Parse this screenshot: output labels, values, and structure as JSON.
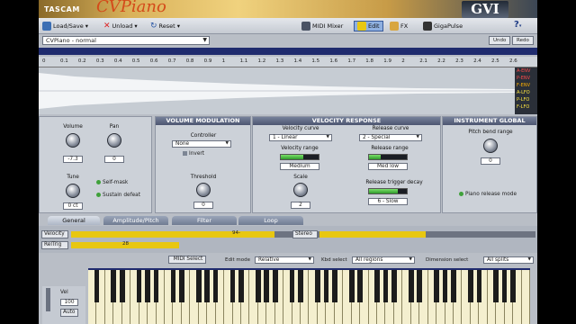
{
  "header": {
    "brand": "TASCAM",
    "product": "CVPiano",
    "logo": "GVI"
  },
  "toolbar": {
    "load_save": "Load/Save",
    "unload": "Unload",
    "reset": "Reset",
    "midi_mixer": "MIDI Mixer",
    "edit": "Edit",
    "fx": "FX",
    "gigapulse": "GigaPulse",
    "help": "?"
  },
  "preset": {
    "name": "CVPiano - normal",
    "undo": "Undo",
    "redo": "Redo"
  },
  "ruler": {
    "ticks": [
      "0",
      "0.1",
      "0.2",
      "0.3",
      "0.4",
      "0.5",
      "0.6",
      "0.7",
      "0.8",
      "0.9",
      "1",
      "1.1",
      "1.2",
      "1.3",
      "1.4",
      "1.5",
      "1.6",
      "1.7",
      "1.8",
      "1.9",
      "2",
      "2.1",
      "2.2",
      "2.3",
      "2.4",
      "2.5",
      "2.6"
    ]
  },
  "envelopes": [
    "A-ENV",
    "P-ENV",
    "F-ENV",
    "A-LFO",
    "P-LFO",
    "F-LFO"
  ],
  "general": {
    "volume_label": "Volume",
    "volume_value": "-7.3",
    "pan_label": "Pan",
    "pan_value": "0",
    "tune_label": "Tune",
    "tune_value": "0 ct",
    "self_mask": "Self-mask",
    "sustain_defeat": "Sustain defeat"
  },
  "volume_modulation": {
    "title": "VOLUME MODULATION",
    "controller_label": "Controller",
    "controller_value": "None",
    "invert": "Invert",
    "threshold_label": "Threshold",
    "threshold_value": "0"
  },
  "velocity_response": {
    "title": "VELOCITY RESPONSE",
    "velocity_curve_label": "Velocity curve",
    "velocity_curve_value": "1 - Linear",
    "release_curve_label": "Release curve",
    "release_curve_value": "2 - Special",
    "velocity_range_label": "Velocity range",
    "velocity_range_value": "Medium",
    "velocity_range_level": 0.6,
    "release_range_label": "Release range",
    "release_range_value": "Med low",
    "release_range_level": 0.3,
    "scale_label": "Scale",
    "scale_value": "2",
    "release_trigger_label": "Release trigger decay",
    "release_trigger_value": "6 - Slow",
    "release_trigger_level": 0.75
  },
  "instrument_global": {
    "title": "INSTRUMENT GLOBAL",
    "pitch_bend_label": "Pitch bend range",
    "pitch_bend_value": "0",
    "piano_release": "Piano release mode"
  },
  "tabs": [
    "General",
    "Amplitude/Pitch",
    "Filter",
    "Loop"
  ],
  "velocity_row": {
    "label": "Velocity",
    "marker": "94-",
    "stereo": "Stereo"
  },
  "reltrig_row": {
    "label": "RelTrig",
    "marker": "28"
  },
  "modes": {
    "midi_select": "MIDI Select",
    "edit_mode_label": "Edit mode",
    "edit_mode_value": "Relative",
    "kbd_select_label": "Kbd select",
    "kbd_select_value": "All regions",
    "dimension_label": "Dimension select",
    "dimension_value": "All splits"
  },
  "keyboard": {
    "vel_label": "Vel",
    "vel_value": "100",
    "auto_label": "Auto"
  },
  "colors": {
    "accent": "#e8c711",
    "header_left": "#d9b15a",
    "header_right": "#3b4655",
    "panel": "#ccd1d8"
  }
}
